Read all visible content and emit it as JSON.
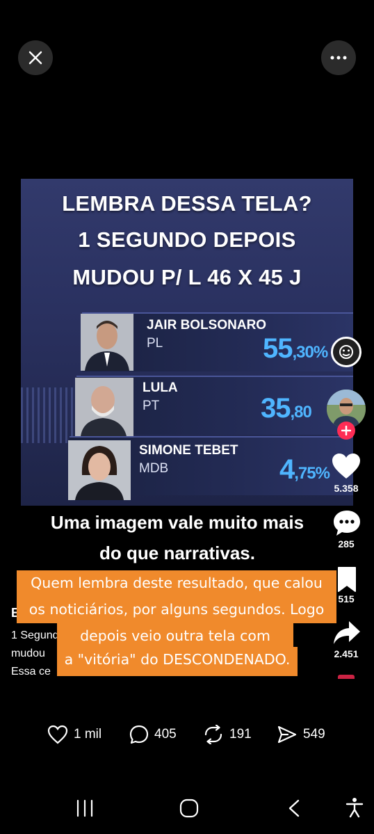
{
  "video": {
    "headline": [
      "LEMBRA DESSA TELA?",
      "1 SEGUNDO DEPOIS",
      "MUDOU P/ L 46 X 45 J"
    ],
    "candidates": [
      {
        "name": "JAIR BOLSONARO",
        "party": "PL",
        "pct_main": "55",
        "pct_dec": ",30%"
      },
      {
        "name": "LULA",
        "party": "PT",
        "pct_main": "35",
        "pct_dec": ",80"
      },
      {
        "name": "SIMONE TEBET",
        "party": "MDB",
        "pct_main": "4",
        "pct_dec": ",75%"
      }
    ],
    "caption": [
      "Uma imagem vale muito mais",
      "do que narrativas."
    ]
  },
  "overlay_text": {
    "lines": [
      "Quem lembra deste resultado, que calou",
      "os noticiários, por alguns segundos. Logo",
      "depois veio outra tela com",
      "a \"vitória\" do DESCONDENADO."
    ]
  },
  "post_text_fragments": {
    "author_initial": "E",
    "line1": "1 Segund",
    "line2": "mudou",
    "line3": "Essa ce"
  },
  "side_actions": {
    "likes": "5.358",
    "comments": "285",
    "saves": "515",
    "shares": "2.451"
  },
  "bottom_actions": {
    "likes": "1 mil",
    "comments": "405",
    "reposts": "191",
    "shares": "549"
  },
  "colors": {
    "accent_red": "#fe2c55",
    "overlay_orange": "#f08a2c",
    "percent_blue": "#4fb5ff"
  }
}
